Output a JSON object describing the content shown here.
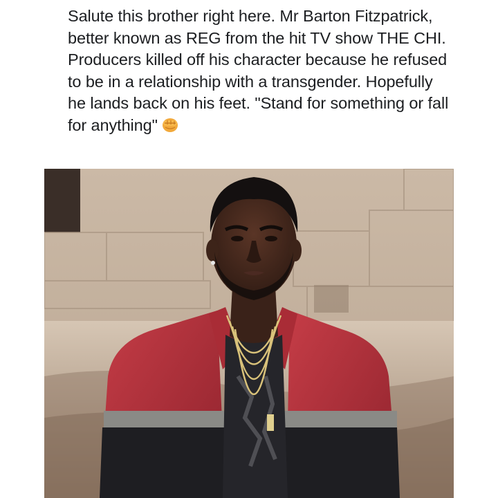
{
  "post": {
    "text": "Salute this brother right here. Mr Barton Fitzpatrick, better known as REG from the hit TV show THE CHI. Producers killed off his character because he refused to be in a relationship with a transgender. Hopefully he lands back on his feet. \"Stand for something or fall for anything\"",
    "emoji": "raised-fist-icon"
  },
  "colors": {
    "background": "#ffffff",
    "text": "#1c1e21",
    "jacket_red": "#b4303a",
    "jacket_dark": "#1e1e22",
    "wall": "#c8b6a4"
  }
}
